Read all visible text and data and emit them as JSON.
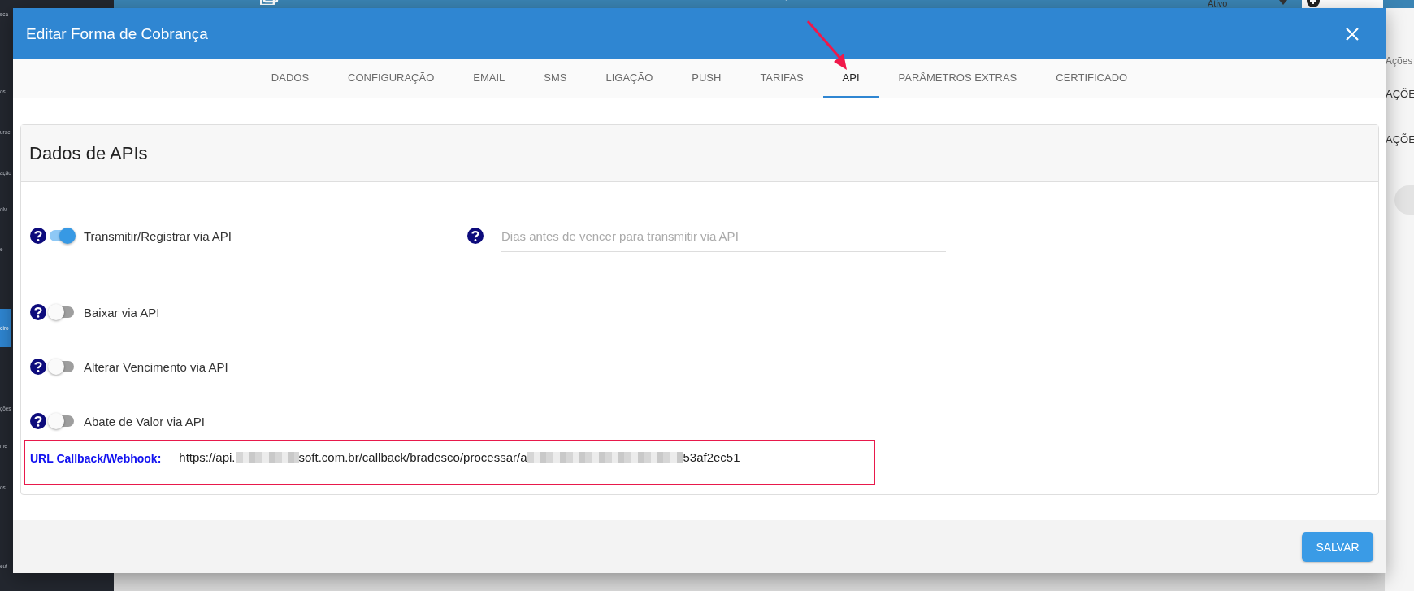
{
  "background": {
    "status": "Ativo",
    "sidebar": [
      {
        "label": "sca",
        "selected": false
      },
      {
        "label": "os",
        "selected": false
      },
      {
        "label": "urac",
        "selected": false
      },
      {
        "label": "ação",
        "selected": false
      },
      {
        "label": "olv",
        "selected": false
      },
      {
        "label": "e",
        "selected": false
      },
      {
        "label": "eiro",
        "selected": true
      },
      {
        "label": "ções",
        "selected": false
      },
      {
        "label": "me",
        "selected": false
      },
      {
        "label": "os",
        "selected": false
      },
      {
        "label": "eut",
        "selected": false
      }
    ],
    "right_panel": [
      "Ações",
      "AÇÕE",
      "AÇÕE"
    ]
  },
  "dialog": {
    "title": "Editar Forma de Cobrança",
    "tabs": [
      {
        "label": "DADOS",
        "selected": false
      },
      {
        "label": "CONFIGURAÇÃO",
        "selected": false
      },
      {
        "label": "EMAIL",
        "selected": false
      },
      {
        "label": "SMS",
        "selected": false
      },
      {
        "label": "LIGAÇÃO",
        "selected": false
      },
      {
        "label": "PUSH",
        "selected": false
      },
      {
        "label": "TARIFAS",
        "selected": false
      },
      {
        "label": "API",
        "selected": true
      },
      {
        "label": "PARÂMETROS EXTRAS",
        "selected": false
      },
      {
        "label": "CERTIFICADO",
        "selected": false
      }
    ],
    "card_title": "Dados de APIs",
    "toggles": [
      {
        "label": "Transmitir/Registrar via API",
        "on": true
      },
      {
        "label": "Baixar via API",
        "on": false
      },
      {
        "label": "Alterar Vencimento via API",
        "on": false
      },
      {
        "label": "Abate de Valor via API",
        "on": false
      }
    ],
    "days_field": {
      "placeholder": "Dias antes de vencer para transmitir via API"
    },
    "callback": {
      "label": "URL Callback/Webhook:",
      "parts": [
        {
          "kind": "text",
          "text": "https://api."
        },
        {
          "kind": "redacted"
        },
        {
          "kind": "text",
          "text": "soft.com.br/callback/bradesco/processar/a"
        },
        {
          "kind": "redacted"
        },
        {
          "kind": "text",
          "text": "53af2ec51"
        }
      ]
    },
    "save_button": "SALVAR"
  }
}
